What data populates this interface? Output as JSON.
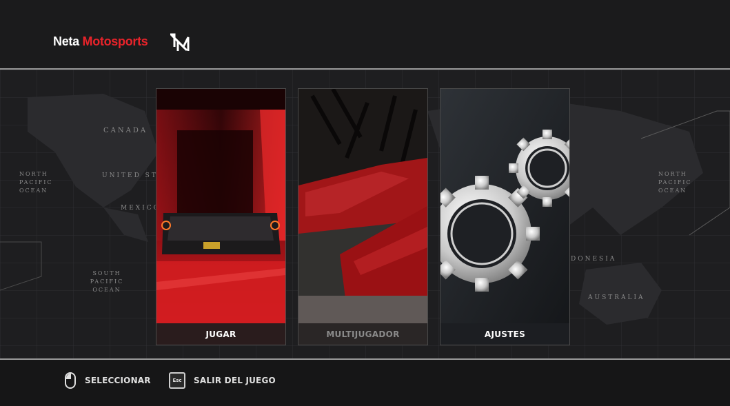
{
  "brand": {
    "name_part1": "Neta",
    "name_part2": "Motosports"
  },
  "colors": {
    "accent": "#e8232a",
    "divider": "#9a9a9a",
    "background": "#1a1a1b"
  },
  "map_labels": {
    "canada": "CANADA",
    "united_states": "UNITED STA",
    "australia": "AUSTRALIA",
    "north_pacific": "NORTH PACIFIC OCEAN",
    "south_pacific": "SOUTH PACIFIC OCEAN",
    "mexico": "MEXICO",
    "north_pacific_right": "NORTH PACIFIC OCEAN",
    "indonesia": "DONESIA"
  },
  "menu": {
    "cards": [
      {
        "label": "JUGAR",
        "icon": "red-supercar-rear-image",
        "selected": true
      },
      {
        "label": "MULTIJUGADOR",
        "icon": "red-sports-cars-image",
        "selected": false
      },
      {
        "label": "AJUSTES",
        "icon": "gears-image",
        "selected": false
      }
    ]
  },
  "controls": {
    "select": {
      "label": "SELECCIONAR",
      "icon": "mouse-icon"
    },
    "exit": {
      "label": "SALIR DEL JUEGO",
      "icon": "esc-key-icon",
      "key": "Esc"
    }
  }
}
